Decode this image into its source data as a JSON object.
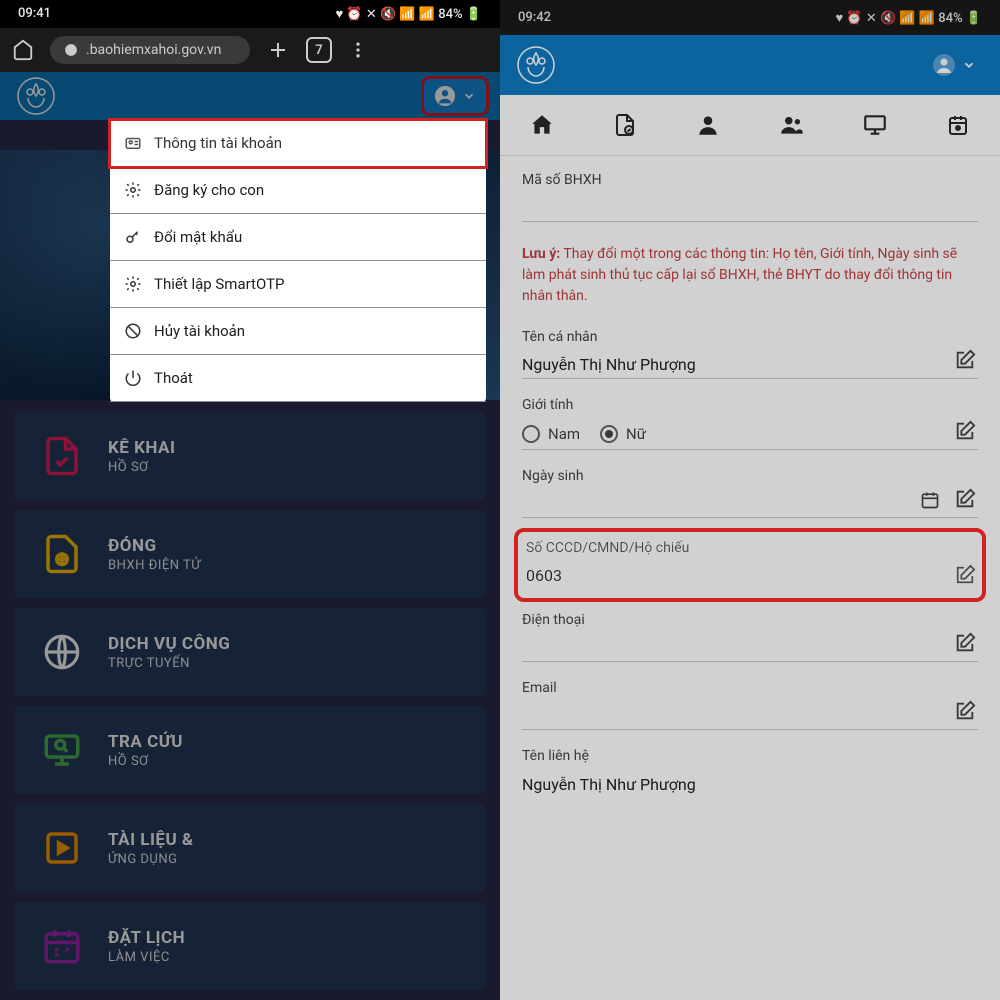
{
  "status": {
    "time_left": "09:41",
    "time_right": "09:42",
    "battery": "84%"
  },
  "browser": {
    "url": ".baohiemxahoi.gov.vn",
    "tab_count": "7"
  },
  "dropdown": {
    "items": [
      {
        "label": "Thông tin tài khoản",
        "icon": "id-card"
      },
      {
        "label": "Đăng ký cho con",
        "icon": "gear"
      },
      {
        "label": "Đổi mật khẩu",
        "icon": "key"
      },
      {
        "label": "Thiết lập SmartOTP",
        "icon": "gear"
      },
      {
        "label": "Hủy tài khoản",
        "icon": "cancel"
      },
      {
        "label": "Thoát",
        "icon": "power"
      }
    ]
  },
  "menu_cards": [
    {
      "title": "KÊ KHAI",
      "sub": "HỒ SƠ",
      "icon": "doc",
      "color": "#e91e63"
    },
    {
      "title": "ĐÓNG",
      "sub": "BHXH ĐIỆN TỬ",
      "icon": "pay",
      "color": "#ffc107"
    },
    {
      "title": "DỊCH VỤ CÔNG",
      "sub": "TRỰC TUYẾN",
      "icon": "globe",
      "color": "#fff"
    },
    {
      "title": "TRA CỨU",
      "sub": "HỒ SƠ",
      "icon": "monitor",
      "color": "#4caf50"
    },
    {
      "title": "TÀI LIỆU &",
      "sub": "ỨNG DỤNG",
      "icon": "play",
      "color": "#ff9800"
    },
    {
      "title": "ĐẶT LỊCH",
      "sub": "LÀM VIỆC",
      "icon": "calendar",
      "color": "#9c27b0"
    }
  ],
  "profile": {
    "bhxh_label": "Mã số BHXH",
    "bhxh_value": "",
    "warning_prefix": "Lưu ý:",
    "warning_text": " Thay đổi một trong các thông tin: Họ tên, Giới tính, Ngày sinh sẽ làm phát sinh thủ tục cấp lại sổ BHXH, thẻ BHYT do thay đổi thông tin nhân thân.",
    "name_label": "Tên cá nhân",
    "name_value": "Nguyễn Thị Như Phượng",
    "gender_label": "Giới tính",
    "gender_male": "Nam",
    "gender_female": "Nữ",
    "dob_label": "Ngày sinh",
    "dob_value": "",
    "id_label": "Số CCCD/CMND/Hộ chiếu",
    "id_value": "0603",
    "phone_label": "Điện thoại",
    "phone_value": "",
    "email_label": "Email",
    "email_value": "",
    "contact_label": "Tên liên hệ",
    "contact_value": "Nguyễn Thị Như Phượng"
  }
}
